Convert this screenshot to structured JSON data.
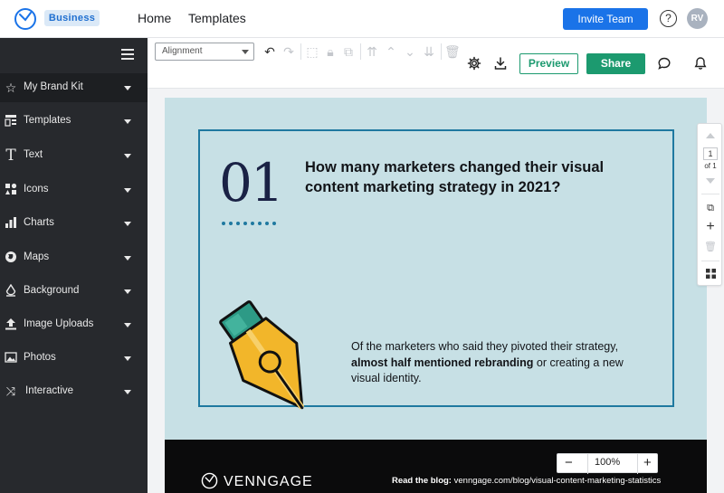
{
  "header": {
    "badge": "Business",
    "nav": [
      "Home",
      "Templates"
    ],
    "invite_label": "Invite Team",
    "help_label": "?",
    "avatar_initials": "RV"
  },
  "sidebar": {
    "items": [
      {
        "label": "My Brand Kit",
        "icon": "star-icon"
      },
      {
        "label": "Templates",
        "icon": "templates-icon"
      },
      {
        "label": "Text",
        "icon": "text-icon"
      },
      {
        "label": "Icons",
        "icon": "icons-icon"
      },
      {
        "label": "Charts",
        "icon": "bar-chart-icon"
      },
      {
        "label": "Maps",
        "icon": "globe-icon"
      },
      {
        "label": "Background",
        "icon": "paint-drop-icon"
      },
      {
        "label": "Image Uploads",
        "icon": "upload-icon"
      },
      {
        "label": "Photos",
        "icon": "photo-icon"
      },
      {
        "label": "Interactive",
        "icon": "shuffle-icon"
      }
    ]
  },
  "toolbar": {
    "alignment_value": "Alignment",
    "preview_label": "Preview",
    "share_label": "Share"
  },
  "canvas": {
    "number": "01",
    "headline": "How many marketers changed their visual content marketing strategy in 2021?",
    "body_prefix": "Of the marketers who said they pivoted their strategy,",
    "body_bold": "almost half mentioned rebranding",
    "body_suffix": "or creating a new visual identity.",
    "footer_brand": "VENNGAGE",
    "footer_blog_label": "Read the blog:",
    "footer_blog_url": "venngage.com/blog/visual-content-marketing-statistics"
  },
  "zoom": {
    "minus": "−",
    "value": "100%",
    "plus": "+"
  },
  "page_nav": {
    "current": "1",
    "of_label": "of 1"
  },
  "colors": {
    "accent_blue": "#1a73e8",
    "share_green": "#1c9a6f",
    "canvas_bg": "#c7e0e5",
    "frame_blue": "#1f79a0",
    "sidebar_bg": "#27292d"
  }
}
